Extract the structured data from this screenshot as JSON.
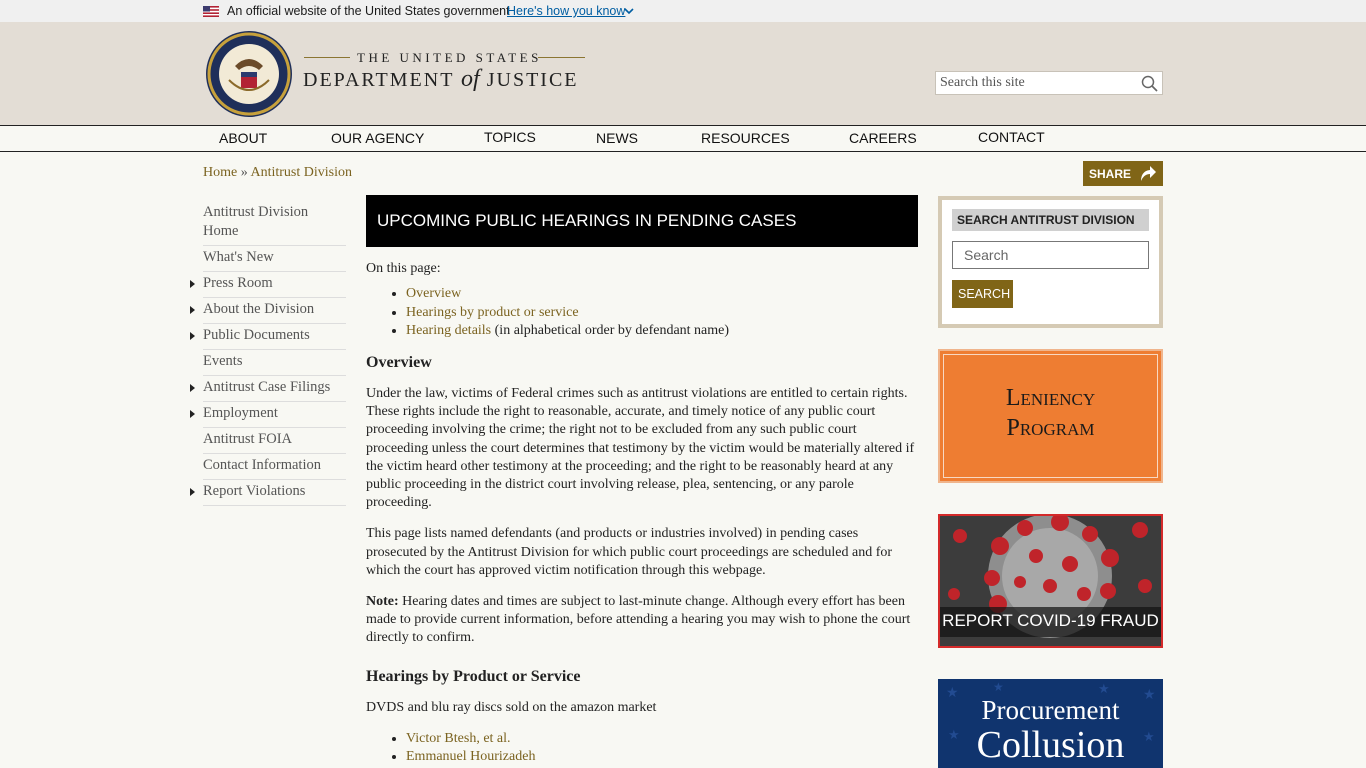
{
  "gov_banner": {
    "official_text": "An official website of the United States government",
    "how_link": "Here's how you know"
  },
  "header": {
    "brand_line1": "THE UNITED STATES",
    "brand_line2_a": "DEPARTMENT",
    "brand_line2_of": "of",
    "brand_line2_b": "JUSTICE",
    "search_placeholder": "Search this site"
  },
  "nav": {
    "items": [
      "ABOUT",
      "OUR AGENCY",
      "TOPICS",
      "NEWS",
      "RESOURCES",
      "CAREERS",
      "CONTACT"
    ]
  },
  "breadcrumb": {
    "home": "Home",
    "separator": "»",
    "current": "Antitrust Division"
  },
  "share_label": "SHARE",
  "leftnav": {
    "items": [
      {
        "label": "Antitrust Division Home",
        "has_arrow": false
      },
      {
        "label": "What's New",
        "has_arrow": false
      },
      {
        "label": "Press Room",
        "has_arrow": true
      },
      {
        "label": "About the Division",
        "has_arrow": true
      },
      {
        "label": "Public Documents",
        "has_arrow": true
      },
      {
        "label": "Events",
        "has_arrow": false
      },
      {
        "label": "Antitrust Case Filings",
        "has_arrow": true
      },
      {
        "label": "Employment",
        "has_arrow": true
      },
      {
        "label": "Antitrust FOIA",
        "has_arrow": false
      },
      {
        "label": "Contact Information",
        "has_arrow": false
      },
      {
        "label": "Report Violations",
        "has_arrow": true
      }
    ]
  },
  "main": {
    "title": "UPCOMING PUBLIC HEARINGS IN PENDING CASES",
    "on_this_page": "On this page:",
    "toc": [
      {
        "link": "Overview",
        "suffix": ""
      },
      {
        "link": "Hearings by product or service",
        "suffix": ""
      },
      {
        "link": "Hearing details",
        "suffix": " (in alphabetical order by defendant name)"
      }
    ],
    "overview_heading": "Overview",
    "overview_p1": "Under the law, victims of Federal crimes such as antitrust violations are entitled to certain rights. These rights include the right to reasonable, accurate, and timely notice of any public court proceeding involving the crime; the right not to be excluded from any such public court proceeding unless the court determines that testimony by the victim would be materially altered if the victim heard other testimony at the proceeding; and the right to be reasonably heard at any public proceeding in the district court involving release, plea, sentencing, or any parole proceeding.",
    "overview_p2": "This page lists named defendants (and products or industries involved) in pending cases prosecuted by the Antitrust Division for which public court proceedings are scheduled and for which the court has approved victim notification through this webpage.",
    "note_label": "Note:",
    "note_text": " Hearing dates and times are subject to last-minute change. Although every effort has been made to provide current information, before attending a hearing you may wish to phone the court directly to confirm.",
    "hearings_heading": "Hearings by Product or Service",
    "product_1": "DVDS and blu ray discs sold on the amazon market",
    "defendants": [
      "Victor Btesh, et al.",
      "Emmanuel Hourizadeh"
    ]
  },
  "sidebar": {
    "search_heading": "SEARCH ANTITRUST DIVISION",
    "search_placeholder": "Search",
    "search_button": "SEARCH",
    "leniency_line1": "Leniency",
    "leniency_line2": "Program",
    "covid_label": "REPORT COVID-19 FRAUD",
    "procure_line1": "Procurement",
    "procure_line2": "Collusion"
  },
  "colors": {
    "gold_link": "#7b6320",
    "gold_button": "#806517",
    "header_bg": "#e3ddd5",
    "leniency_orange": "#ee7d32",
    "covid_red": "#d42a2a",
    "procure_blue": "#10346e"
  }
}
